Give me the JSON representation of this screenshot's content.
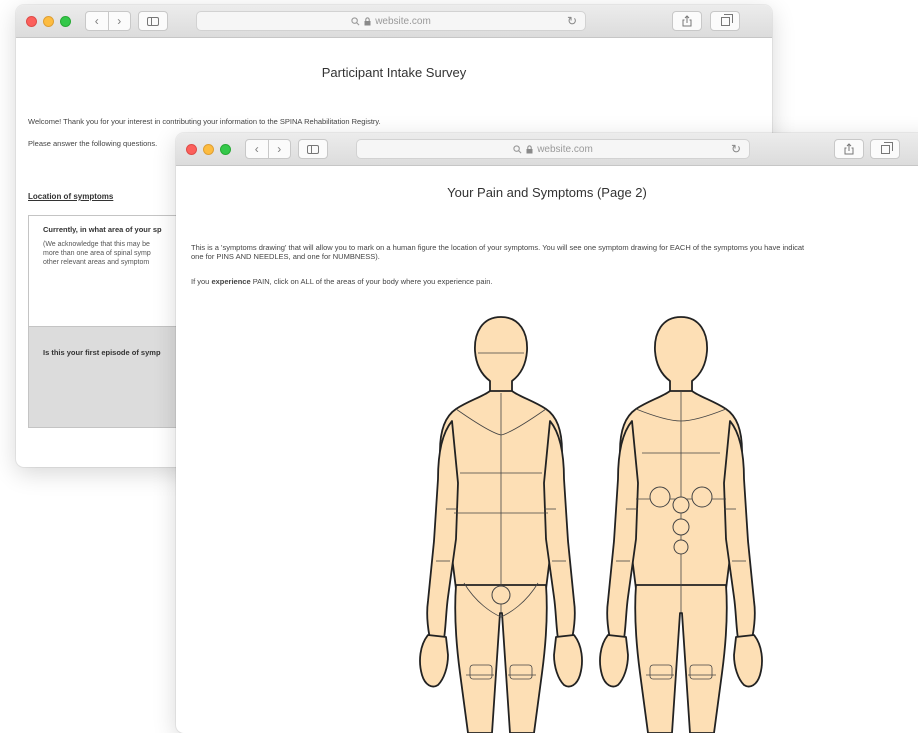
{
  "back_window": {
    "url": "website.com",
    "title": "Participant Intake Survey",
    "welcome": "Welcome! Thank you for your interest in contributing your information to the SPINA Rehabilitation Registry.",
    "instruction": "Please answer the following questions.",
    "section": "Location of symptoms",
    "question1": {
      "heading": "Currently, in what area of your sp",
      "body_lines": [
        "(We acknowledge that this may be",
        "more than one area of spinal symp",
        "other relevant areas and symptom"
      ]
    },
    "question2": {
      "heading": "Is this your first episode of symp"
    }
  },
  "front_window": {
    "url": "website.com",
    "title": "Your Pain and Symptoms (Page 2)",
    "intro_line1": "This is a 'symptoms drawing' that will allow you to mark on a human figure the location of your symptoms. You will see one symptom drawing for EACH of the symptoms you have indicat",
    "intro_line2": "one for PINS AND NEEDLES, and one for NUMBNESS).",
    "pain_prefix": "If you ",
    "pain_bold": "experience",
    "pain_suffix": " PAIN, click on ALL of the areas of your body where you experience pain."
  },
  "icons": {
    "back": "chevron-left-icon",
    "forward": "chevron-right-icon",
    "sidebar": "sidebar-icon",
    "lock": "lock-icon",
    "search": "search-icon",
    "reload": "reload-icon",
    "share": "share-icon",
    "tabs": "tabs-icon"
  },
  "colors": {
    "skin": "#fddfb5",
    "outline": "#222222",
    "close": "#fc605c",
    "minimize": "#fdbc40",
    "zoom": "#34c84a"
  }
}
